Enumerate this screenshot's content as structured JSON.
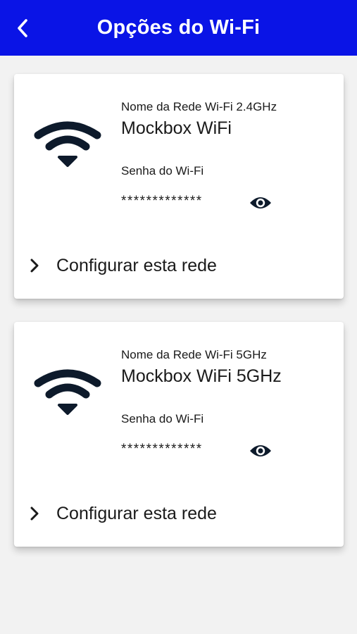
{
  "header": {
    "title": "Opções do Wi-Fi",
    "background": "#0a14e6",
    "back_icon": "chevron-left-icon"
  },
  "networks": [
    {
      "band_label": "Nome da Rede Wi-Fi 2.4GHz",
      "ssid": "Mockbox WiFi",
      "password_label": "Senha do Wi-Fi",
      "password_masked": "*************",
      "toggle_icon": "eye-icon",
      "configure_label": "Configurar esta rede",
      "configure_icon": "chevron-right-icon",
      "wifi_icon": "wifi-icon"
    },
    {
      "band_label": "Nome da Rede Wi-Fi 5GHz",
      "ssid": "Mockbox WiFi 5GHz",
      "password_label": "Senha do Wi-Fi",
      "password_masked": "*************",
      "toggle_icon": "eye-icon",
      "configure_label": "Configurar esta rede",
      "configure_icon": "chevron-right-icon",
      "wifi_icon": "wifi-icon"
    }
  ]
}
